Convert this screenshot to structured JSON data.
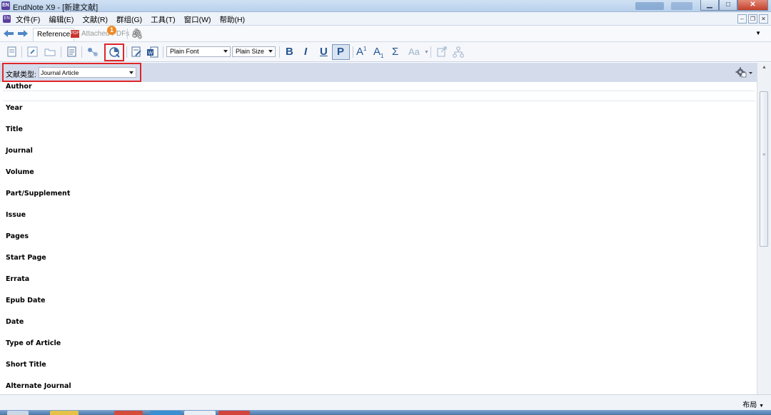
{
  "window": {
    "title": "EndNote X9 - [新建文献]",
    "app_icon": "EN"
  },
  "menu": [
    "文件(F)",
    "编辑(E)",
    "文献(R)",
    "群组(G)",
    "工具(T)",
    "窗口(W)",
    "帮助(H)"
  ],
  "tabs": {
    "reference": "Reference",
    "attached_pdfs": "Attached PDFs"
  },
  "annotation_badge": "1",
  "toolbar": {
    "font": "Plain Font",
    "size": "Plain Size",
    "bold": "B",
    "italic": "I",
    "underline": "U",
    "plain": "P",
    "superscript": "A",
    "superscript_mark": "1",
    "subscript": "A",
    "subscript_mark": "1",
    "symbol": "Σ",
    "case": "Aa"
  },
  "reference_type": {
    "label": "文献类型:",
    "value": "Journal Article"
  },
  "fields": [
    "Author",
    "Year",
    "Title",
    "Journal",
    "Volume",
    "Part/Supplement",
    "Issue",
    "Pages",
    "Start Page",
    "Errata",
    "Epub Date",
    "Date",
    "Type of Article",
    "Short Title",
    "Alternate Journal"
  ],
  "status": {
    "layout": "布局"
  },
  "colors": {
    "highlight": "#e0262a",
    "badge": "#f08a24",
    "accent": "#26558f"
  }
}
